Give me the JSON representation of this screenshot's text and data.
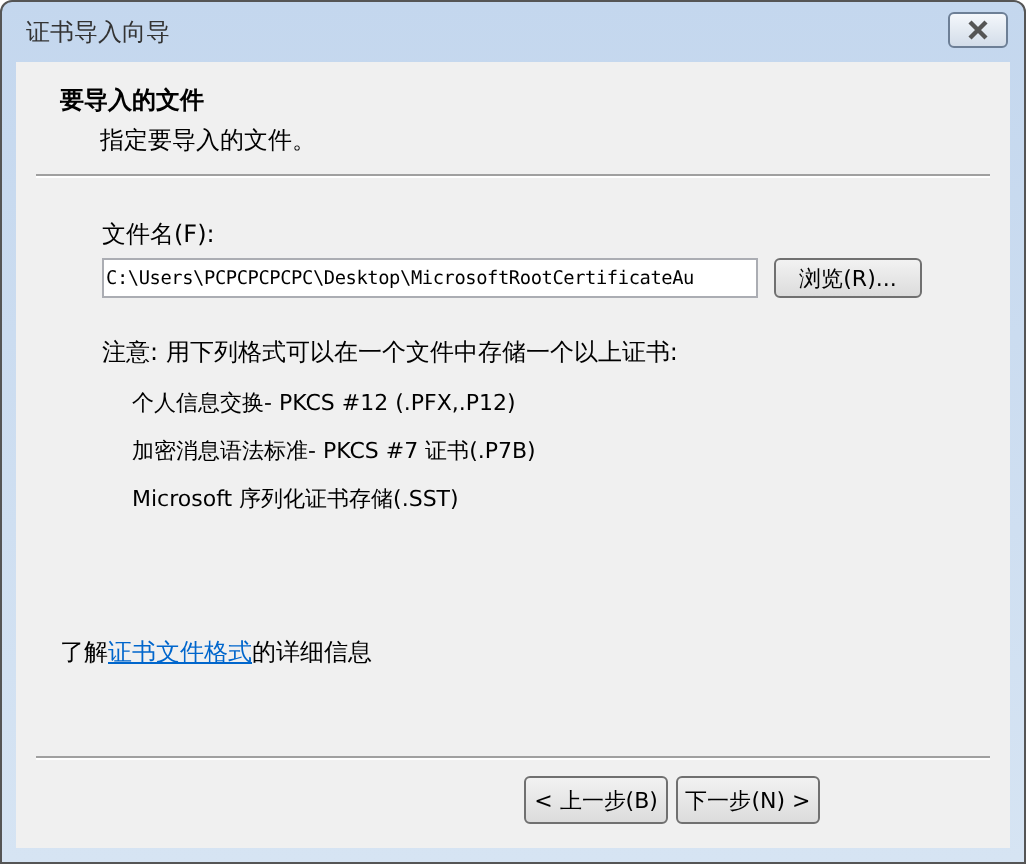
{
  "window": {
    "title": "证书导入向导"
  },
  "header": {
    "title": "要导入的文件",
    "subtitle": "指定要导入的文件。"
  },
  "file_field": {
    "label": "文件名(F):",
    "value": "C:\\Users\\PCPCPCPCPC\\Desktop\\MicrosoftRootCertificateAu",
    "browse_button": "浏览(R)..."
  },
  "note": {
    "text": "注意: 用下列格式可以在一个文件中存储一个以上证书:",
    "formats": [
      "个人信息交换- PKCS #12 (.PFX,.P12)",
      "加密消息语法标准- PKCS #7 证书(.P7B)",
      "Microsoft 序列化证书存储(.SST)"
    ]
  },
  "info": {
    "prefix": "了解",
    "link": "证书文件格式",
    "suffix": "的详细信息"
  },
  "buttons": [
    {
      "label": "< 上一步(B)"
    },
    {
      "label": "下一步(N) >"
    }
  ]
}
